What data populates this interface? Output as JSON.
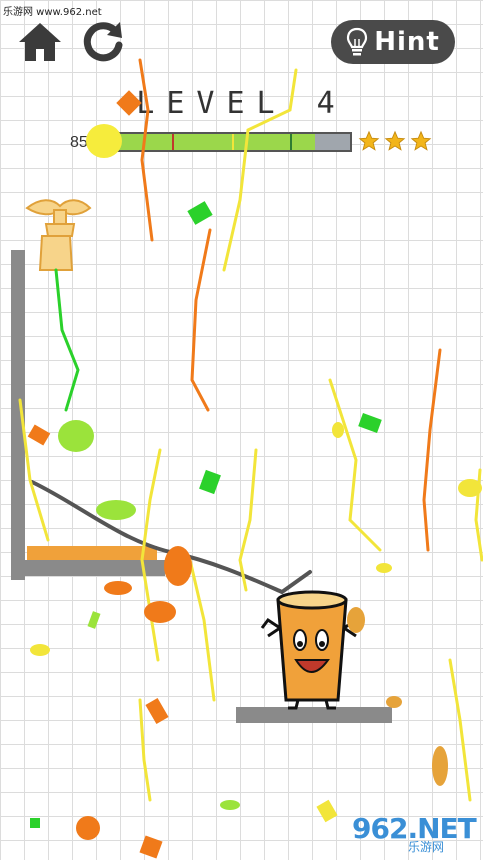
{
  "watermark_top": "乐游网 www.962.net",
  "header": {
    "home_icon": "home-icon",
    "restart_icon": "restart-icon",
    "hint_label": "Hint",
    "hint_icon": "lightbulb-icon"
  },
  "level": {
    "title": "LEVEL 4",
    "progress_count": "85",
    "progress_fraction": 0.85,
    "stars": 3
  },
  "colors": {
    "progress_fill": "#9bd74b",
    "progress_track": "#a0a6ad",
    "hint_bg": "#4a4a4a",
    "cup_fill": "#f0a13a",
    "star": "#f2b51a",
    "confetti": [
      "#f07a1a",
      "#f2e53a",
      "#2bd12b",
      "#9be33b"
    ]
  },
  "watermark_bottom": {
    "brand": "962.NET",
    "sub": "乐游网"
  }
}
